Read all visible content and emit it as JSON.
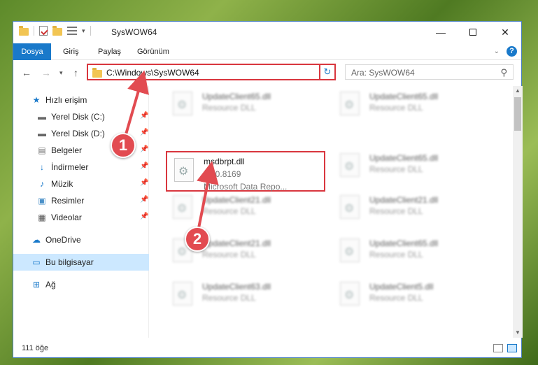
{
  "window": {
    "title": "SysWOW64",
    "ribbon_tabs": [
      "Dosya",
      "Giriş",
      "Paylaş",
      "Görünüm"
    ]
  },
  "address": {
    "path": "C:\\Windows\\SysWOW64",
    "search_placeholder": "Ara: SysWOW64"
  },
  "sidebar": {
    "items": [
      {
        "label": "Hızlı erişim",
        "icon": "star-icon"
      },
      {
        "label": "Yerel Disk (C:)",
        "icon": "drive-icon"
      },
      {
        "label": "Yerel Disk (D:)",
        "icon": "drive-icon"
      },
      {
        "label": "Belgeler",
        "icon": "documents-icon"
      },
      {
        "label": "İndirmeler",
        "icon": "download-icon"
      },
      {
        "label": "Müzik",
        "icon": "music-icon"
      },
      {
        "label": "Resimler",
        "icon": "pictures-icon"
      },
      {
        "label": "Videolar",
        "icon": "video-icon"
      },
      {
        "label": "OneDrive",
        "icon": "cloud-icon"
      },
      {
        "label": "Bu bilgisayar",
        "icon": "computer-icon"
      },
      {
        "label": "Ağ",
        "icon": "network-icon"
      }
    ]
  },
  "files": {
    "highlighted": {
      "name": "msdbrpt.dll",
      "version": "6.00.8169",
      "description": "Microsoft Data Repo..."
    },
    "blurred": [
      {
        "name": "UpdateClient65.dll",
        "type": "Resource DLL"
      },
      {
        "name": "UpdateClient65.dll",
        "type": "Resource DLL"
      },
      {
        "name": "UpdateClient65.dll",
        "type": "Resource DLL"
      },
      {
        "name": "UpdateClient21.dll",
        "type": "Resource DLL"
      },
      {
        "name": "UpdateClient21.dll",
        "type": "Resource DLL"
      },
      {
        "name": "UpdateClient21.dll",
        "type": "Resource DLL"
      },
      {
        "name": "UpdateClient65.dll",
        "type": "Resource DLL"
      },
      {
        "name": "UpdateClient63.dll",
        "type": "Resource DLL"
      },
      {
        "name": "UpdateClient5.dll",
        "type": "Resource DLL"
      }
    ]
  },
  "status": {
    "item_count": "111 öğe"
  },
  "markers": [
    "1",
    "2"
  ],
  "colors": {
    "accent": "#1979ca",
    "highlight_red": "#d9363e",
    "marker_red": "#e24b51"
  }
}
